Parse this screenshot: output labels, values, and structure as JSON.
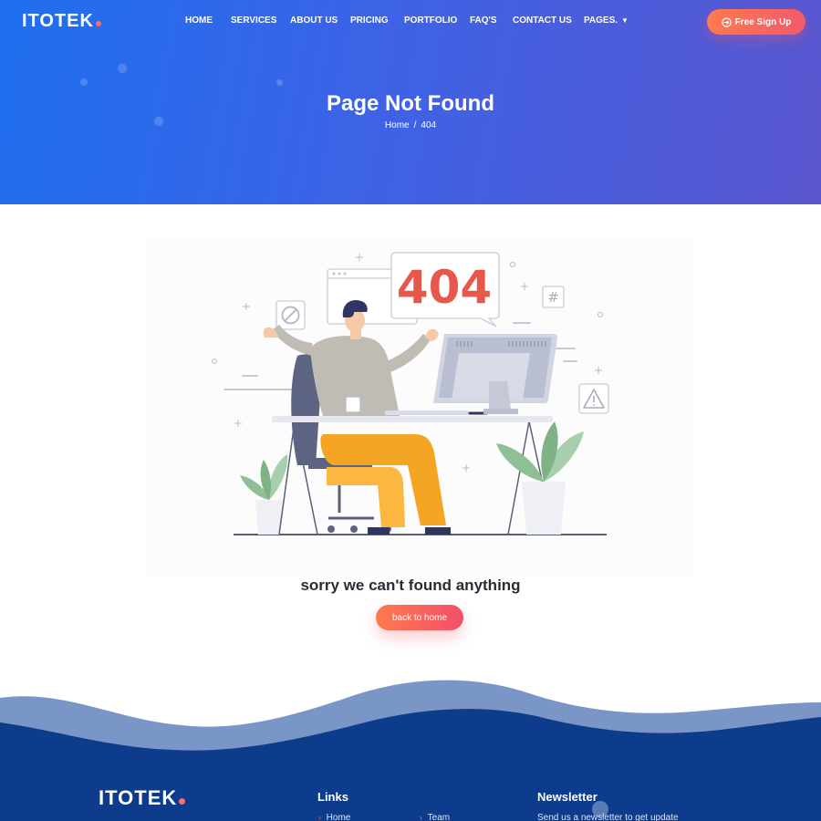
{
  "brand": {
    "logo_text": "ITOTEK",
    "accent": "#ff6b6b"
  },
  "nav": {
    "items": [
      "HOME",
      "SERVICES",
      "ABOUT US",
      "PRICING",
      "PORTFOLIO",
      "FAQ'S",
      "CONTACT US",
      "PAGES."
    ],
    "signup_label": "Free Sign Up"
  },
  "hero": {
    "title": "Page Not Found",
    "breadcrumb": {
      "home": "Home",
      "separator": "/",
      "current": "404"
    }
  },
  "illustration": {
    "code": "404",
    "hash_symbol": "#"
  },
  "message": {
    "text": "sorry we can't found anything",
    "button_label": "back to home"
  },
  "footer": {
    "logo_text": "ITOTEK",
    "links_title": "Links",
    "links": [
      "Home",
      "Team"
    ],
    "newsletter_title": "Newsletter",
    "newsletter_text": "Send us a newsletter to get update"
  },
  "colors": {
    "hero_start": "#1f6ff0",
    "hero_end": "#5a56cf",
    "button": "#f25a6a",
    "footer": "#0e3c8c"
  }
}
